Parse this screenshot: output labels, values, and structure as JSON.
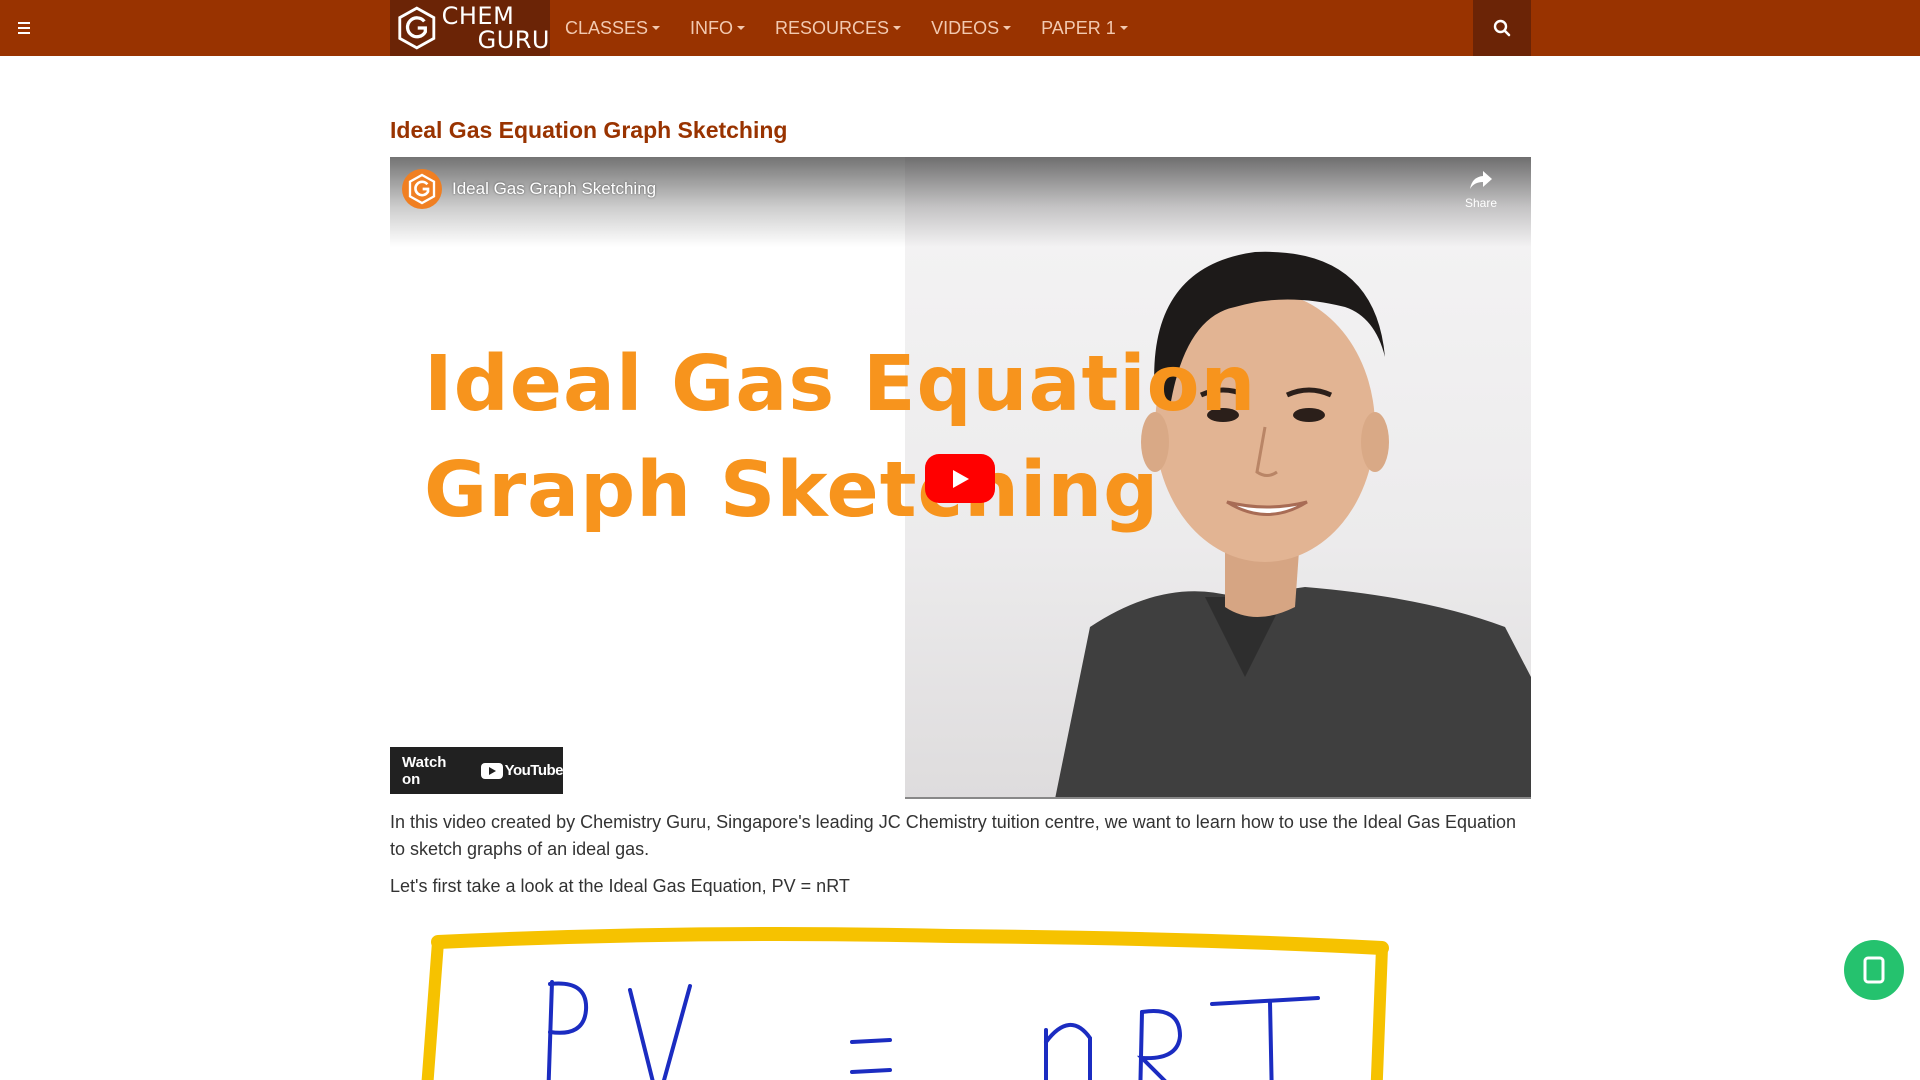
{
  "nav": {
    "menu_icon": "hamburger-icon",
    "logo": {
      "line1": "CHEM",
      "line2": "GURU"
    },
    "items": [
      {
        "label": "CLASSES"
      },
      {
        "label": "INFO"
      },
      {
        "label": "RESOURCES"
      },
      {
        "label": "VIDEOS"
      },
      {
        "label": "PAPER 1"
      }
    ],
    "search_icon": "search-icon",
    "colors": {
      "bar": "#993300",
      "dark": "#6b2406",
      "text": "#f2c9b0"
    }
  },
  "page": {
    "title": "Ideal Gas Equation Graph Sketching",
    "title_color": "#993300"
  },
  "video": {
    "title": "Ideal Gas Graph Sketching",
    "share_label": "Share",
    "thumbnail_line1": "Ideal Gas Equation",
    "thumbnail_line2": "Graph Sketching",
    "watch_on_label": "Watch on",
    "youtube_label": "YouTube",
    "thumbnail_color": "#f7941d",
    "play_color": "#ff0000"
  },
  "content": {
    "paragraph1": "In this video created by Chemistry Guru, Singapore's leading JC Chemistry tuition centre, we want to learn how to use the Ideal Gas Equation to sketch graphs of an ideal gas.",
    "paragraph2": "Let's first take a look at the Ideal Gas Equation, PV = nRT",
    "equation_image_text": "PV = nRT"
  },
  "floating_button": {
    "icon": "whatsapp-icon",
    "color": "#25c26e"
  }
}
